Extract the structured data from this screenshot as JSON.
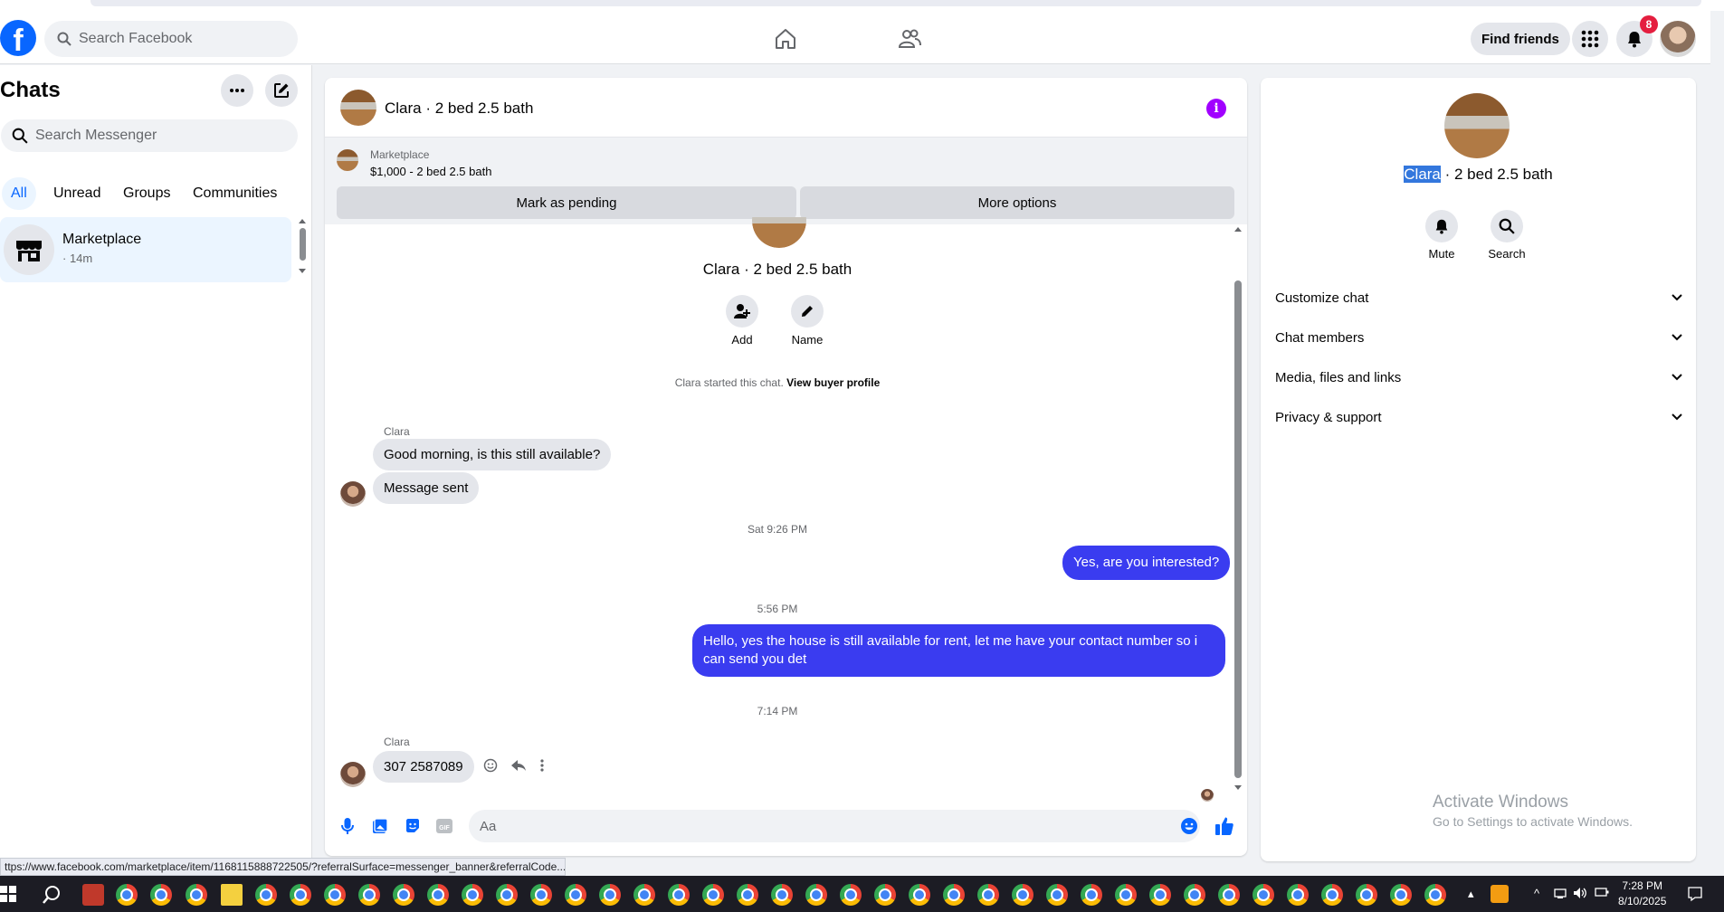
{
  "topnav": {
    "search_placeholder": "Search Facebook",
    "find_friends": "Find friends",
    "notification_count": "8"
  },
  "left": {
    "title": "Chats",
    "search_placeholder": "Search Messenger",
    "filters": [
      "All",
      "Unread",
      "Groups",
      "Communities"
    ],
    "chats": [
      {
        "name": "Marketplace",
        "time": "· 14m"
      }
    ]
  },
  "chat": {
    "header_title": "Clara · 2 bed 2.5 bath",
    "marketplace_label": "Marketplace",
    "listing": "$1,000 - 2 bed 2.5 bath",
    "mark_pending": "Mark as pending",
    "more_options": "More options",
    "profile_title": "Clara · 2 bed 2.5 bath",
    "add_label": "Add",
    "name_label": "Name",
    "started_text": "Clara started this chat.",
    "view_buyer": "View buyer profile",
    "messages": [
      {
        "sender": "Clara",
        "text": "Good morning, is this still available?"
      },
      {
        "text": "Message sent"
      },
      {
        "timestamp": "Sat 9:26 PM"
      },
      {
        "text": "Yes, are you interested?"
      },
      {
        "timestamp": "5:56 PM"
      },
      {
        "text": "Hello, yes the house is still available for rent, let me have your contact number so i can send you det"
      },
      {
        "timestamp": "7:14 PM"
      },
      {
        "sender": "Clara",
        "text": "307 2587089"
      }
    ],
    "composer_placeholder": "Aa"
  },
  "right": {
    "title_highlight": "Clara",
    "title_rest": " · 2 bed 2.5 bath",
    "mute_label": "Mute",
    "search_label": "Search",
    "sections": [
      "Customize chat",
      "Chat members",
      "Media, files and links",
      "Privacy & support"
    ],
    "activate_title": "Activate Windows",
    "activate_sub": "Go to Settings to activate Windows."
  },
  "status_url": "ttps://www.facebook.com/marketplace/item/1168115888722505/?referralSurface=messenger_banner&referralCode...",
  "taskbar": {
    "time": "7:28 PM",
    "date": "8/10/2025"
  },
  "colors": {
    "facebook_blue": "#0866ff",
    "outgoing_bubble": "#3a3cf0",
    "info_purple": "#a100ff",
    "badge_red": "#e41e3f"
  }
}
